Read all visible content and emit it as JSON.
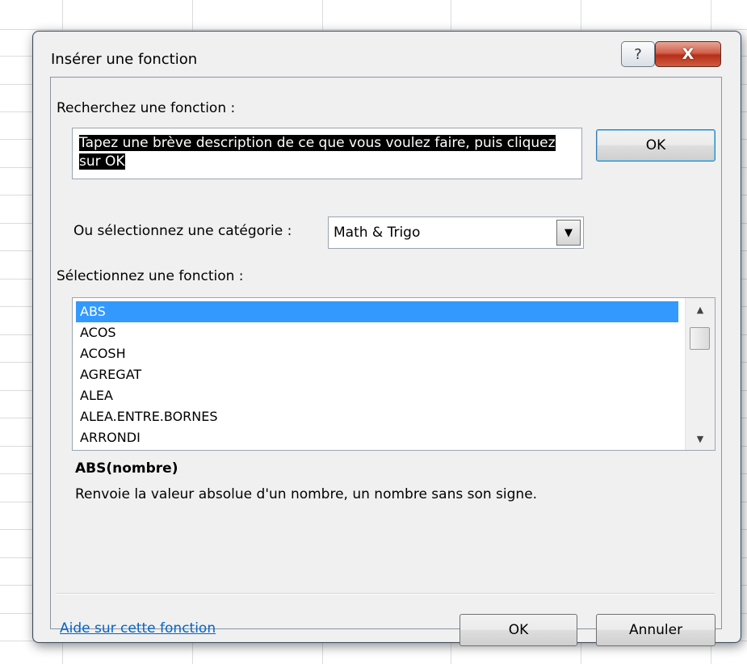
{
  "dialog": {
    "title": "Insérer une fonction",
    "help_button": "?",
    "close_button": "X"
  },
  "search": {
    "label": "Recherchez une fonction :",
    "text": "Tapez une brève description de ce que vous voulez faire, puis cliquez sur OK",
    "ok_button": "OK"
  },
  "category": {
    "label": "Ou sélectionnez une catégorie :",
    "selected": "Math & Trigo"
  },
  "functions": {
    "label": "Sélectionnez une fonction :",
    "items": [
      "ABS",
      "ACOS",
      "ACOSH",
      "AGREGAT",
      "ALEA",
      "ALEA.ENTRE.BORNES",
      "ARRONDI"
    ],
    "selected": "ABS"
  },
  "details": {
    "syntax": "ABS(nombre)",
    "description": "Renvoie la valeur absolue d'un nombre, un nombre sans son signe."
  },
  "footer": {
    "help_link": "Aide sur cette fonction",
    "ok_button": "OK",
    "cancel_button": "Annuler"
  },
  "colors": {
    "selection": "#3399ff",
    "link": "#0066cc",
    "close_button": "#c0452c"
  }
}
